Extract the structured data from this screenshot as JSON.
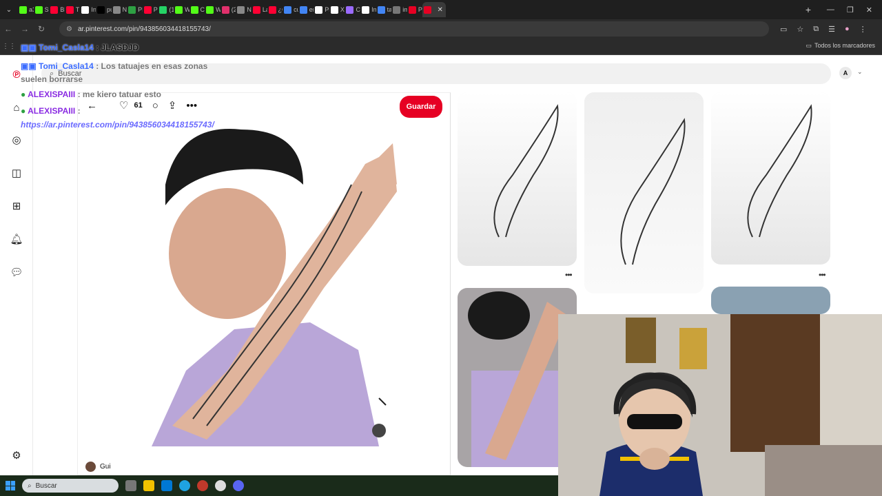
{
  "browser": {
    "tabs": [
      {
        "title": "a3i",
        "color": "#53fc18"
      },
      {
        "title": "Str",
        "color": "#53fc18"
      },
      {
        "title": "Bh",
        "color": "#ff0033"
      },
      {
        "title": "TIN",
        "color": "#ff0033"
      },
      {
        "title": "Ini",
        "color": "#ffffff"
      },
      {
        "title": "pu",
        "color": "#000000"
      },
      {
        "title": "Nu",
        "color": "#888888"
      },
      {
        "title": "PR",
        "color": "#2ea043"
      },
      {
        "title": "Pe",
        "color": "#ff0033"
      },
      {
        "title": "(14",
        "color": "#25d366"
      },
      {
        "title": "We",
        "color": "#53fc18"
      },
      {
        "title": "Ch",
        "color": "#53fc18"
      },
      {
        "title": "We",
        "color": "#53fc18"
      },
      {
        "title": "(2",
        "color": "#e1306c"
      },
      {
        "title": "Nu",
        "color": "#888888"
      },
      {
        "title": "La",
        "color": "#ff0033"
      },
      {
        "title": "¿C",
        "color": "#ff0033"
      },
      {
        "title": "cu",
        "color": "#4285f4"
      },
      {
        "title": "en",
        "color": "#4285f4"
      },
      {
        "title": "Pi",
        "color": "#ffffff"
      },
      {
        "title": "XE",
        "color": "#ffffff"
      },
      {
        "title": "Ca",
        "color": "#9b6bff"
      },
      {
        "title": "Ini",
        "color": "#ffffff"
      },
      {
        "title": "ta",
        "color": "#4285f4"
      },
      {
        "title": "im",
        "color": "#777777"
      },
      {
        "title": "Pir",
        "color": "#e60023"
      },
      {
        "title": "",
        "color": "#e60023",
        "active": true
      }
    ],
    "url": "ar.pinterest.com/pin/943856034418155743/",
    "bookmarks_all": "Todos los marcadores"
  },
  "pinterest": {
    "search_placeholder": "Buscar",
    "account_initial": "A",
    "like_count": "61",
    "save_label": "Guardar",
    "author": "Gui"
  },
  "overlay_chat": [
    {
      "user": "Tomi_Casla14",
      "msg": " : JLASDJD",
      "user_color": "#3b6cff"
    },
    {
      "user": "Tomi_Casla14",
      "msg": " : Los tatuajes en esas zonas suelen borrarse",
      "user_color": "#3b6cff"
    },
    {
      "user": "ALEXISPAIII",
      "msg": " : me kiero tatuar esto",
      "user_color": "#8a2be2"
    },
    {
      "user": "ALEXISPAIII",
      "msg": " :",
      "user_color": "#8a2be2"
    },
    {
      "link": "https://ar.pinterest.com/pin/943856034418155743/"
    }
  ],
  "taskbar": {
    "search_placeholder": "Buscar"
  },
  "colors": {
    "accent": "#e60023",
    "chat_user": "#3b6cff",
    "chat_user2": "#8a2be2"
  }
}
